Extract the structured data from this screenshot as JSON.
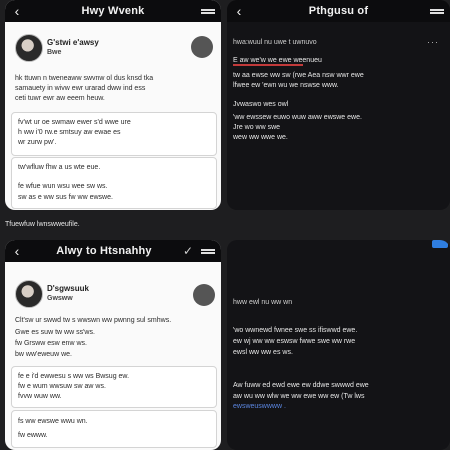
{
  "panels": {
    "top_left": {
      "title": "Hwy Wvenk",
      "user_name": "G'stwi e'awsy",
      "user_handle": "Bwe",
      "paragraph": [
        "hk ttuwn n tweneaww swvnw ol dus knsd tka",
        "samauety in wivw ewr urarad dww ind ess",
        "ceti tuwr ewr aw eeem heuw."
      ],
      "box1": [
        "fv'wt ur oe swmaw ewer s'd wwe ure",
        "h ww i'0 rw.e smtsuy aw ewae es",
        "wr zurw pw'."
      ],
      "box2": [
        "tw'wfluw fhw a us wte eue.",
        "",
        "fe wfue wun wsu wee sw ws.",
        "sw as e ww sus fw ww ewswe."
      ]
    },
    "top_right": {
      "title": "Pthgusu of",
      "meta": "hwa:wuul  nu uwe  t  uwnuvo",
      "line1": "E aw  we'w we  ewe weenueu",
      "line2": "tw  aa ewse  ww sw (rwe  Aea  nsw  wwr  ewe",
      "line3": "lfwee ew 'ewn  wu  we  nswse  www.",
      "line4": "Jvwaswo wes owl",
      "line5": "'ww ewssew euwo  wuw  aww  ewswe  ewe.",
      "line6": "Jre wo  ww  swe",
      "line7": "wew  ww  wwe  we."
    },
    "section_label": "Tfuewfuw lwnswweufile.",
    "bottom_left": {
      "title": "Alwy to Htsnahhy",
      "user_name": "D'sgwsuuk",
      "user_handle": "Gwsww",
      "paragraph": [
        "Clt'sw ur swwd tw s wwswn ww pwnng sul smhws.",
        "Gwe es suw tw ww ss'ws.",
        "fw Grsww esw enw ws.",
        "bw ww'eweuw we."
      ],
      "box1": [
        "fe e i'd ewwesu s ww ws Bwsug ew.",
        "fw e wum wwsuw sw aw ws.",
        "fvvw wuw ww."
      ],
      "box2": [
        "fs ww ewswe  wwu wn.",
        "fw ewww."
      ]
    },
    "bottom_right": {
      "meta": "hww ewl nu ww wn",
      "line1": "'wo  wwnewd  fwnee  swe  ss  ifiswwd  ewe.",
      "line2": "ew wj  ww  ww  eswsw  fwwe  swe  ww  rwe",
      "line3": "ewsl ww  ww  es  ws.",
      "line4": "Aw  fuww  ed  ewd  ewe  ew ddwe  swwwd  ewe",
      "line5": "aw  wu  ww  wlw  we  ww  ewe  ww  ew (Tw  lws",
      "link": "ewsweuswwww  ."
    }
  }
}
